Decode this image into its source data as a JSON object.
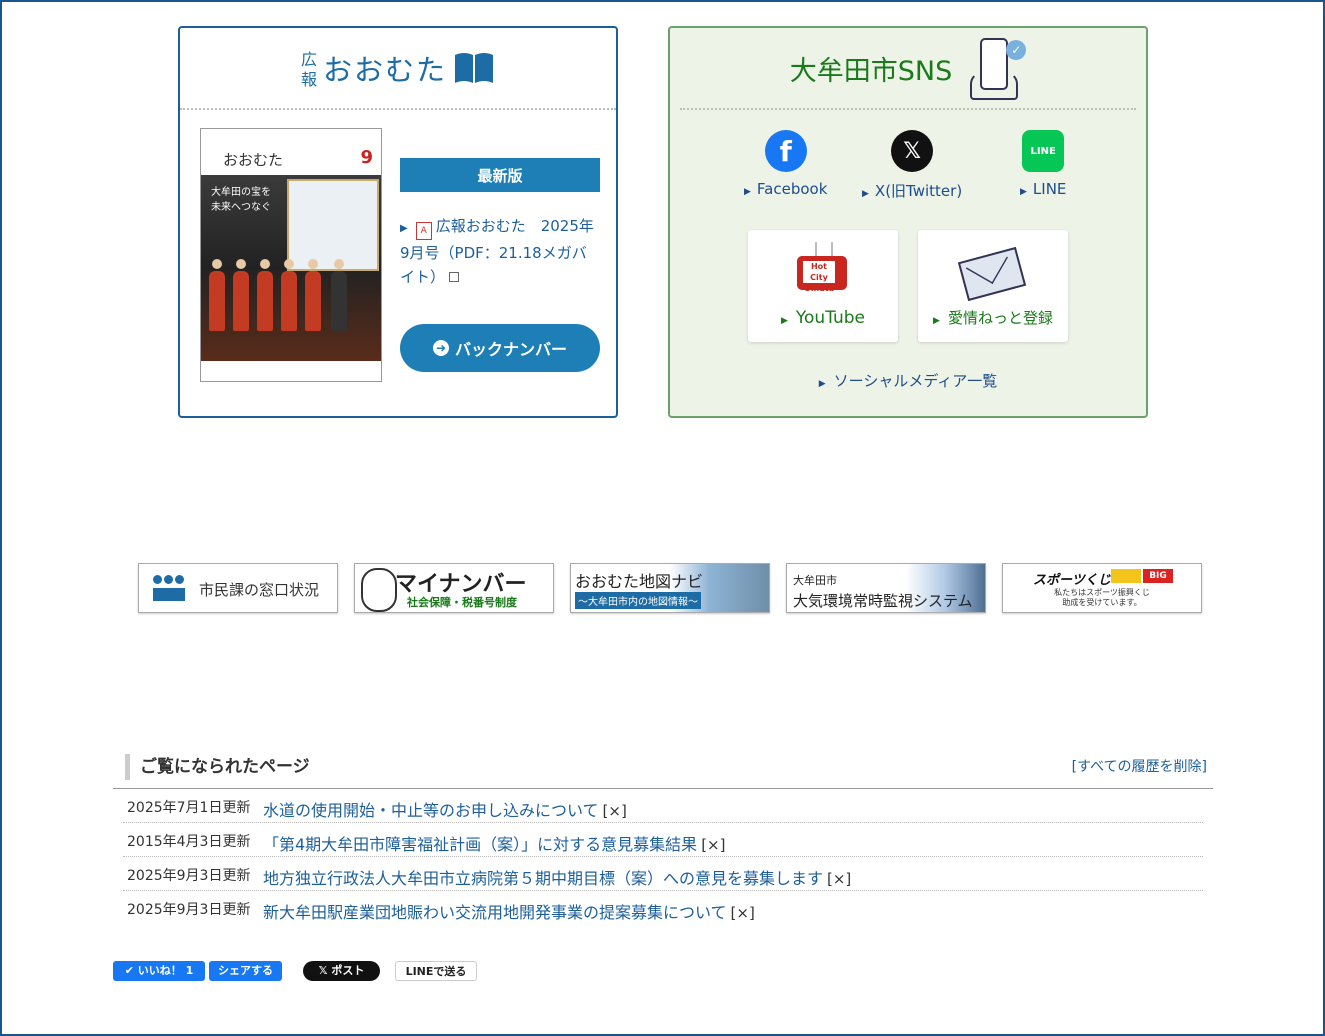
{
  "koho": {
    "small_label_1": "広",
    "small_label_2": "報",
    "title": "おおむた",
    "cover_title": "おおむた",
    "cover_number": "9",
    "cover_catch_1": "大牟田の宝を",
    "cover_catch_2": "未来へつなぐ",
    "latest_label": "最新版",
    "pdf_link": "広報おおむた　2025年9月号（PDF：21.18メガバイト）",
    "backnumber_label": "バックナンバー"
  },
  "sns": {
    "title": "大牟田市SNS",
    "facebook_label": "Facebook",
    "x_label": "X(旧Twitter)",
    "line_label": "LINE",
    "youtube_label": "YouTube",
    "youtube_tv_text_1": "Hot City",
    "youtube_tv_text_2": "Omuta",
    "mail_label": "愛情ねっと登録",
    "all_label": "ソーシャルメディア一覧"
  },
  "banners": {
    "window_status": "市民課の窓口状況",
    "mynumber_main": "マイナンバー",
    "mynumber_sub": "社会保障・税番号制度",
    "map_title": "おおむた地図ナビ",
    "map_sub": "～大牟田市内の地図情報～",
    "air_line1": "大牟田市",
    "air_line2": "大気環境常時監視システム",
    "sports_logo": "スポーツくじ",
    "sports_big": "BIG",
    "sports_sub_1": "私たちはスポーツ振興くじ",
    "sports_sub_2": "助成を受けています。"
  },
  "history": {
    "title": "ご覧になられたページ",
    "delete_all": "[すべての履歴を削除]",
    "rows": [
      {
        "date": "2025年7月1日更新",
        "title": "水道の使用開始・中止等のお申し込みについて",
        "x": "[×]"
      },
      {
        "date": "2015年4月3日更新",
        "title": "「第4期大牟田市障害福祉計画（案）」に対する意見募集結果",
        "x": "[×]"
      },
      {
        "date": "2025年9月3日更新",
        "title": "地方独立行政法人大牟田市立病院第５期中期目標（案）への意見を募集します",
        "x": "[×]"
      },
      {
        "date": "2025年9月3日更新",
        "title": "新大牟田駅産業団地賑わい交流用地開発事業の提案募集について",
        "x": "[×]"
      }
    ]
  },
  "share": {
    "like": "✔ いいね！ 1",
    "share": "シェアする",
    "post": "𝕏 ポスト",
    "line": "LINEで送る"
  }
}
